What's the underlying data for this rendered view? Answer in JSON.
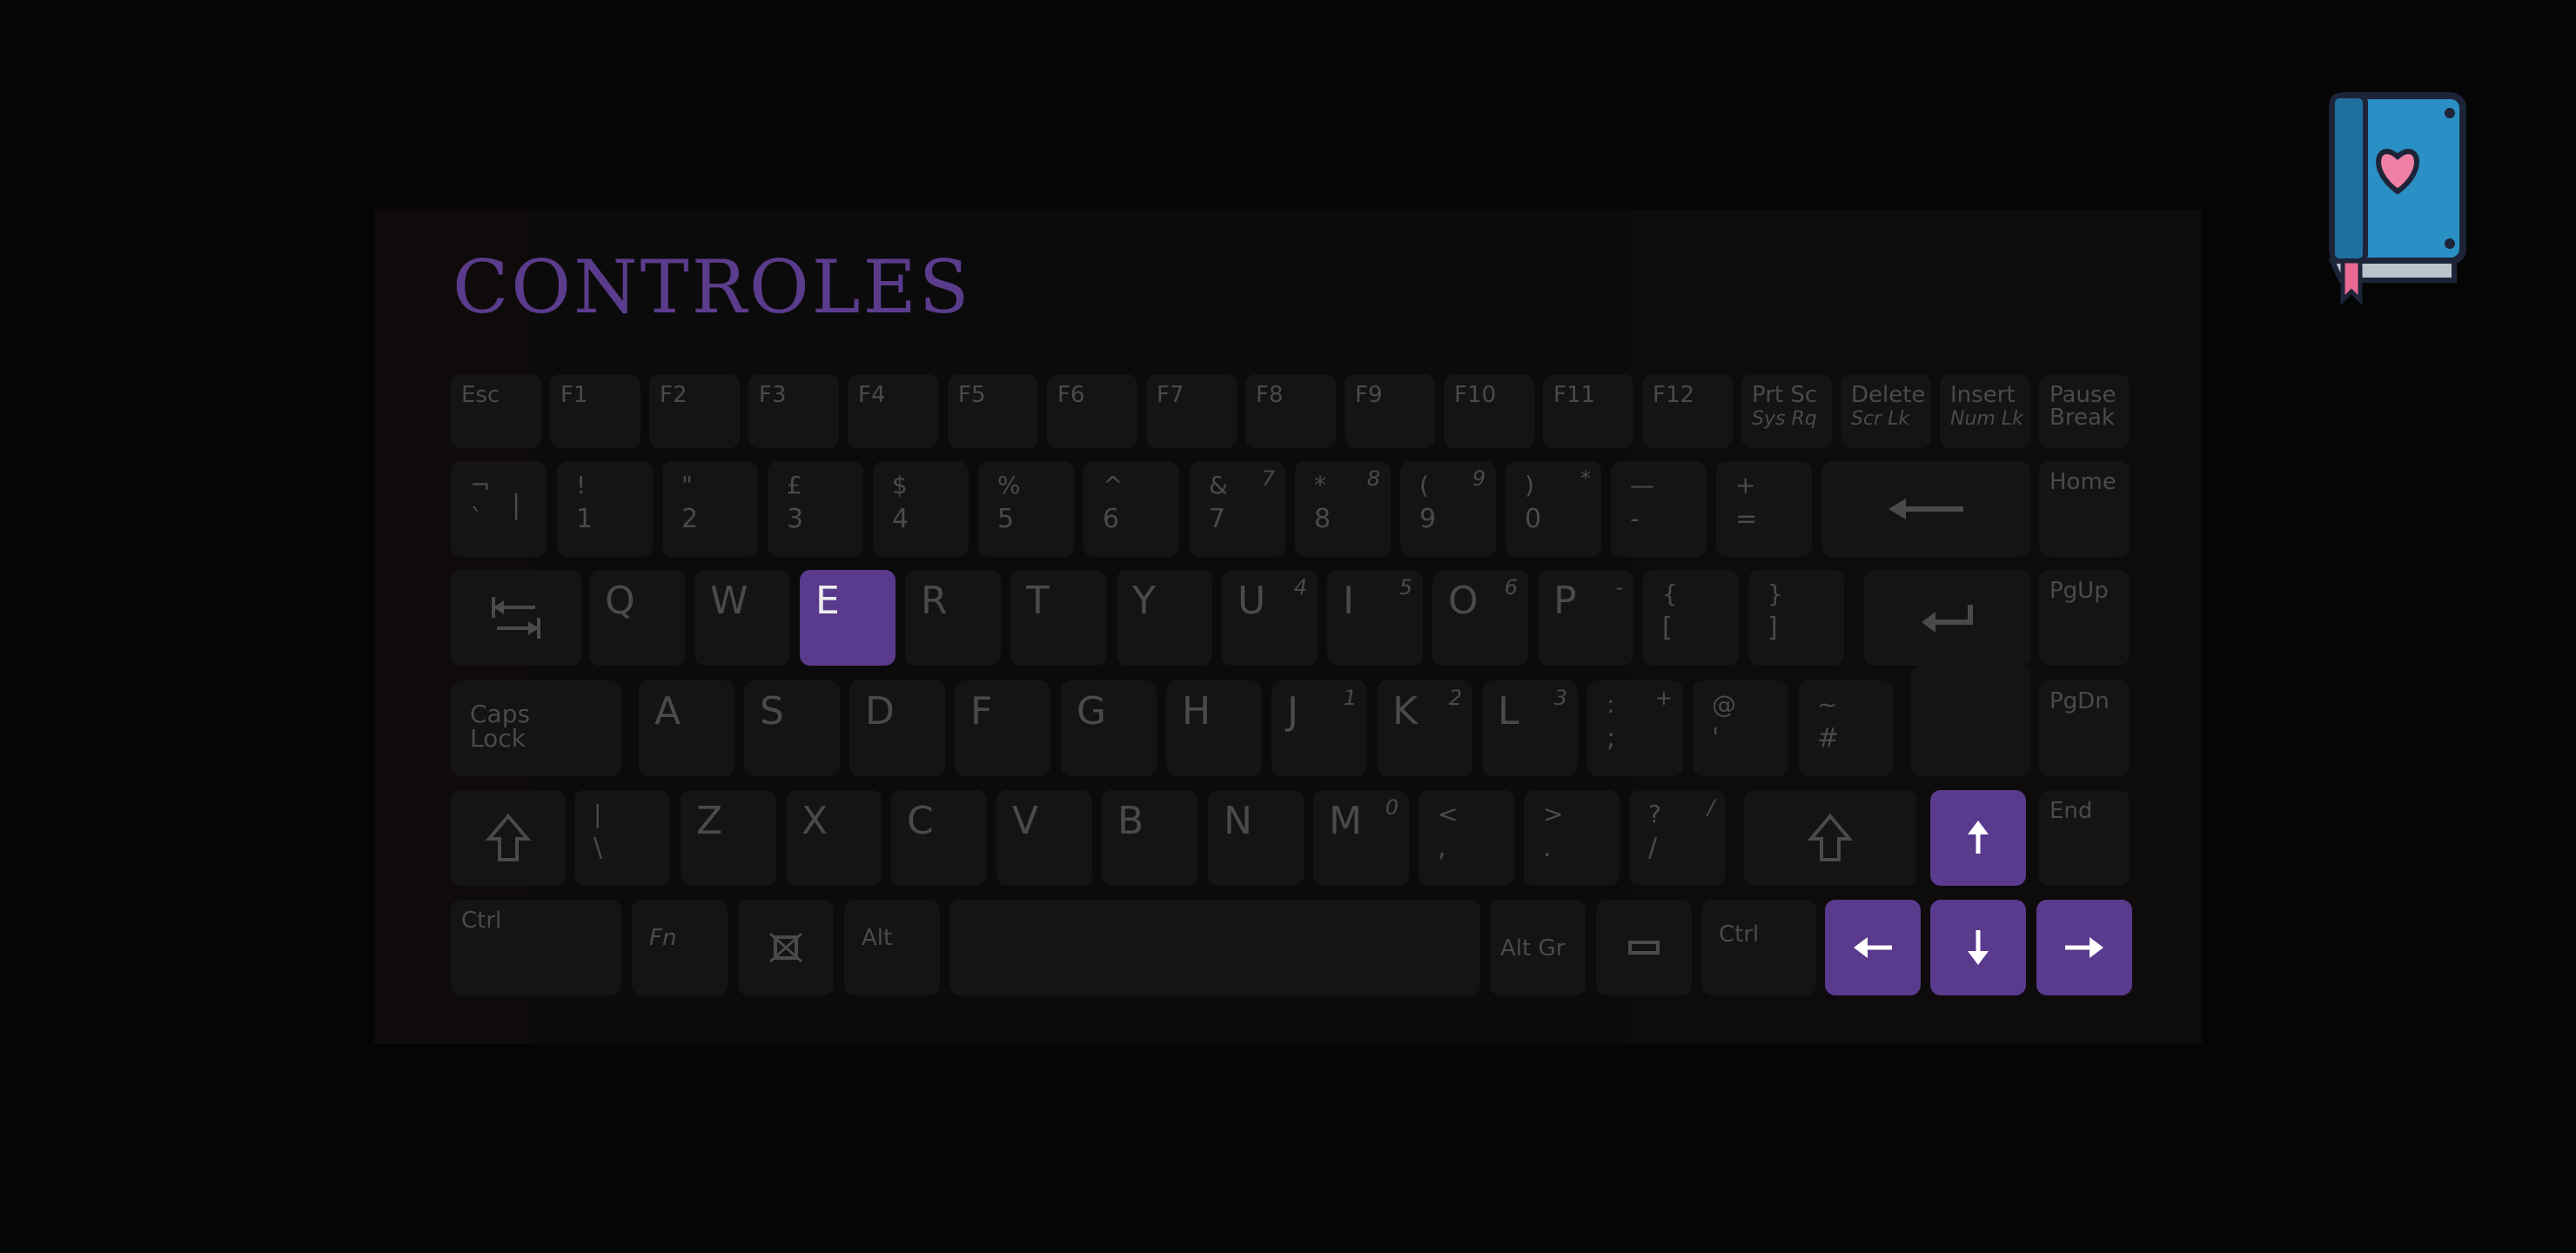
{
  "title": "CONTROLES",
  "keyboard": {
    "row0": [
      "Esc",
      "F1",
      "F2",
      "F3",
      "F4",
      "F5",
      "F6",
      "F7",
      "F8",
      "F9",
      "F10",
      "F11",
      "F12"
    ],
    "prtsc": {
      "top": "Prt Sc",
      "sub": "Sys Rq"
    },
    "delete": {
      "top": "Delete",
      "sub": "Scr Lk"
    },
    "insert": {
      "top": "Insert",
      "sub": "Num Lk"
    },
    "pause": {
      "top": "Pause",
      "bot": "Break"
    },
    "row1": [
      {
        "top": "¬",
        "bot": "`",
        "right": "|"
      },
      {
        "top": "!",
        "bot": "1"
      },
      {
        "top": "\"",
        "bot": "2"
      },
      {
        "top": "£",
        "bot": "3"
      },
      {
        "top": "$",
        "bot": "4"
      },
      {
        "top": "%",
        "bot": "5"
      },
      {
        "top": "^",
        "bot": "6"
      },
      {
        "top": "&",
        "bot": "7",
        "corner": "7"
      },
      {
        "top": "*",
        "bot": "8",
        "corner": "8"
      },
      {
        "top": "(",
        "bot": "9",
        "corner": "9"
      },
      {
        "top": ")",
        "bot": "0",
        "corner": "*"
      },
      {
        "top": "—",
        "bot": "-"
      },
      {
        "top": "+",
        "bot": "="
      }
    ],
    "home": "Home",
    "row2": [
      {
        "l": "Q"
      },
      {
        "l": "W"
      },
      {
        "l": "E"
      },
      {
        "l": "R"
      },
      {
        "l": "T"
      },
      {
        "l": "Y"
      },
      {
        "l": "U",
        "corner": "4"
      },
      {
        "l": "I",
        "corner": "5"
      },
      {
        "l": "O",
        "corner": "6"
      },
      {
        "l": "P",
        "corner": "-"
      },
      {
        "top": "{",
        "bot": "["
      },
      {
        "top": "}",
        "bot": "]"
      }
    ],
    "pgup": "PgUp",
    "caps": {
      "top": "Caps",
      "bot": "Lock"
    },
    "row3": [
      {
        "l": "A"
      },
      {
        "l": "S"
      },
      {
        "l": "D"
      },
      {
        "l": "F"
      },
      {
        "l": "G"
      },
      {
        "l": "H"
      },
      {
        "l": "J",
        "corner": "1"
      },
      {
        "l": "K",
        "corner": "2"
      },
      {
        "l": "L",
        "corner": "3"
      },
      {
        "top": ":",
        "bot": ";",
        "corner": "+"
      },
      {
        "top": "@",
        "bot": "'"
      },
      {
        "top": "~",
        "bot": "#"
      }
    ],
    "pgdn": "PgDn",
    "row4": [
      {
        "top": "|",
        "bot": "\\"
      },
      {
        "l": "Z"
      },
      {
        "l": "X"
      },
      {
        "l": "C"
      },
      {
        "l": "V"
      },
      {
        "l": "B"
      },
      {
        "l": "N"
      },
      {
        "l": "M",
        "corner": "0"
      },
      {
        "top": "<",
        "bot": ","
      },
      {
        "top": ">",
        "bot": "."
      },
      {
        "top": "?",
        "bot": "/",
        "corner": "/"
      }
    ],
    "end": "End",
    "ctrl_left": "Ctrl",
    "fn": "Fn",
    "alt": "Alt",
    "altgr": "Alt Gr",
    "ctrl_right": "Ctrl",
    "highlighted": [
      "E",
      "up",
      "down",
      "left",
      "right"
    ]
  },
  "colors": {
    "background": "#050506",
    "key": "#141414",
    "key_text": "#4a4a4a",
    "highlight": "#5a3a8c",
    "highlight_text": "#eeeeee",
    "title": "#5b3c8c"
  },
  "icons": {
    "journal": "book-heart-icon",
    "tab": "tab-icon",
    "backspace": "backspace-arrow-icon",
    "enter": "enter-arrow-icon",
    "shift": "shift-arrow-icon",
    "windows": "menu-key-icon",
    "context": "context-menu-icon",
    "arrows": [
      "arrow-up-icon",
      "arrow-down-icon",
      "arrow-left-icon",
      "arrow-right-icon"
    ]
  }
}
